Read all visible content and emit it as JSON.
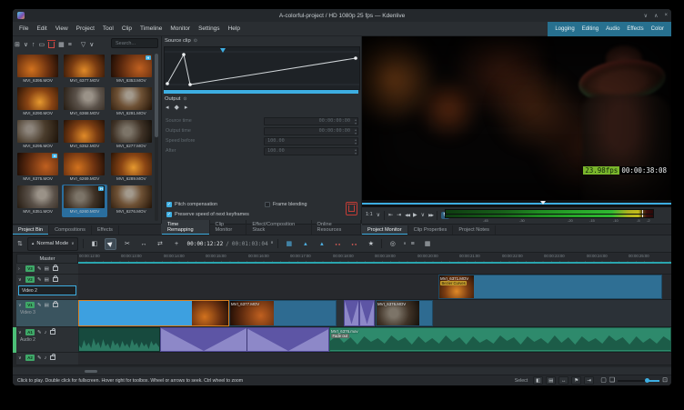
{
  "titlebar": {
    "title": "A-colorful-project / HD 1080p 25 fps — Kdenlive"
  },
  "menubar": {
    "items": [
      "File",
      "Edit",
      "View",
      "Project",
      "Tool",
      "Clip",
      "Timeline",
      "Monitor",
      "Settings",
      "Help"
    ]
  },
  "workspaces": [
    "Logging",
    "Editing",
    "Audio",
    "Effects",
    "Color"
  ],
  "bin": {
    "search_placeholder": "Search...",
    "clips": [
      {
        "name": "MVI_6395.MOV"
      },
      {
        "name": "MVI_6377.MOV"
      },
      {
        "name": "MVI_6353.MOV",
        "badge": "H"
      },
      {
        "name": "MVI_6290.MOV"
      },
      {
        "name": "MVI_6368.MOV"
      },
      {
        "name": "MVI_6291.MOV"
      },
      {
        "name": "MVI_6295.MOV"
      },
      {
        "name": "MVI_6352.MOV"
      },
      {
        "name": "MVI_6277.MOV"
      },
      {
        "name": "MVI_6375.MOV",
        "badge": "H"
      },
      {
        "name": "MVI_6269.MOV"
      },
      {
        "name": "MVI_6289.MOV"
      },
      {
        "name": "MVI_6351.MOV"
      },
      {
        "name": "MVI_6260.MOV",
        "badge": "H",
        "selected": true
      },
      {
        "name": "MVI_6276.MOV"
      }
    ]
  },
  "remap": {
    "source_label": "Source clip",
    "output_label": "Output",
    "fields": [
      {
        "label": "Source time",
        "value": "00:00:00:00"
      },
      {
        "label": "Output time",
        "value": "00:00:00:00"
      },
      {
        "label": "Speed before",
        "value": "100.00"
      },
      {
        "label": "After",
        "value": "100.00"
      }
    ],
    "checkboxes": [
      {
        "label": "Pitch compensation",
        "checked": true
      },
      {
        "label": "Frame blending",
        "checked": false
      },
      {
        "label": "Preserve speed of next keyframes",
        "checked": true
      }
    ]
  },
  "monitor": {
    "fps_overlay": "23.98fps",
    "timecode_overlay": "00:00:38:08",
    "zoom_level": "1:1",
    "timecode": "00:00:38:08",
    "meter_scale": [
      "-45",
      "-30",
      "-20",
      "-15",
      "-10",
      "-5",
      "-2"
    ]
  },
  "tabs": {
    "left": [
      "Project Bin",
      "Compositions",
      "Effects"
    ],
    "middle": [
      "Time Remapping",
      "Clip Monitor",
      "Effect/Composition Stack",
      "Online Resources"
    ],
    "right": [
      "Project Monitor",
      "Clip Properties",
      "Project Notes"
    ]
  },
  "toolbar": {
    "mode": "Normal Mode",
    "position_timecode": "00:00:12:22",
    "separator": "/",
    "duration_timecode": "00:01:03:04"
  },
  "timeline": {
    "master": "Master",
    "ruler": [
      "00:00:12:00",
      "00:00:13:00",
      "00:00:14:00",
      "00:00:15:00",
      "00:00:16:00",
      "00:00:17:00",
      "00:00:18:00",
      "00:00:19:00",
      "00:00:20:00",
      "00:00:21:00",
      "00:00:22:00",
      "00:00:23:00",
      "00:00:24:00",
      "00:00:25:00"
    ],
    "tracks": [
      {
        "tag": "V3",
        "name": ""
      },
      {
        "tag": "V2",
        "name": "Video 2"
      },
      {
        "tag": "V1",
        "name": "Video 3"
      },
      {
        "tag": "A1",
        "name": "Audio 2"
      },
      {
        "tag": "A2",
        "name": ""
      }
    ],
    "clips": {
      "v2_label": "MVI_6371.MOV",
      "v2_badge": "Bezier Curves",
      "v1_b_label": "MVI_6377.MOV",
      "v1_d_label": "MVI_6376.MOV",
      "a1_c_label": "MVI_6376.mov",
      "a1_c_badge": "Fade out"
    }
  },
  "statusbar": {
    "hint": "Click to play. Double click for fullscreen. Hover right for toolbox. Wheel or arrows to seek. Ctrl wheel to zoom",
    "select_label": "Select"
  },
  "icons": {
    "minimize": "∨",
    "maximize": "∧",
    "close": "×",
    "add_clip": "⊞",
    "chevron_down": "∨",
    "parent_folder": "↑",
    "folder": "▭",
    "generate": "▦",
    "view_mode": "≡",
    "filter": "▽",
    "pin": "⊙",
    "prev_keyframe": "◂",
    "add_keyframe": "◆",
    "next_keyframe": "▸",
    "zone_start": "⇤",
    "zone_end": "⇥",
    "rewind": "◀◀",
    "play": "▶",
    "forward": "▶▶",
    "loop": "↻",
    "menu": "≡",
    "track_height": "⇅",
    "razor": "✂",
    "spacer": "↔",
    "slip": "⇄",
    "multicam": "+",
    "mix": "▦",
    "keyframe": "▴",
    "dots": "●●",
    "star": "★",
    "record": "◎",
    "pen": "✎",
    "film": "▤",
    "note": "♪",
    "tag": "◧",
    "arrows": "↔",
    "flag": "⚑",
    "marker": "⇥",
    "dashed": "▢",
    "overlap": "❏",
    "fit": "⊡",
    "check": "✓",
    "typewriter": "▦"
  }
}
